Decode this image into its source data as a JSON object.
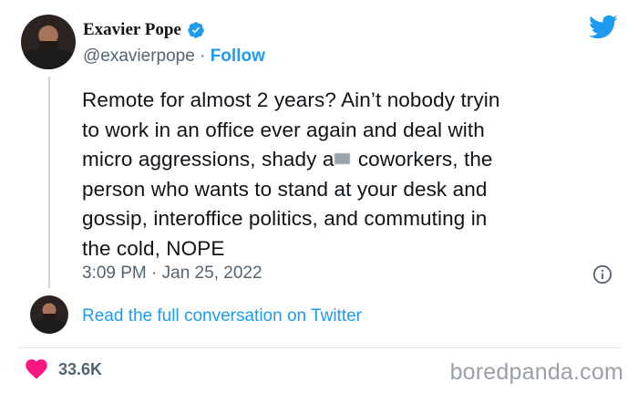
{
  "author": {
    "name": "Exavier Pope",
    "handle": "@exavierpope",
    "separator": " · ",
    "follow_label": "Follow"
  },
  "tweet": {
    "text_before_censor": "Remote for almost 2 years? Ain’t nobody tryin\nto work in an office ever again and deal with\nmicro aggressions, shady a",
    "text_after_censor": " coworkers, the\nperson who wants to stand at your desk and\ngossip, interoffice politics, and commuting in\nthe cold, NOPE",
    "timestamp": "3:09 PM · Jan 25, 2022"
  },
  "conversation_link": "Read the full conversation on Twitter",
  "likes": {
    "count": "33.6K"
  },
  "watermark": "boredpanda.com",
  "colors": {
    "accent": "#1d9bf0",
    "heart": "#f91880",
    "muted": "#536471"
  },
  "icons": [
    "verified-badge-icon",
    "twitter-bird-icon",
    "info-icon",
    "heart-icon"
  ]
}
